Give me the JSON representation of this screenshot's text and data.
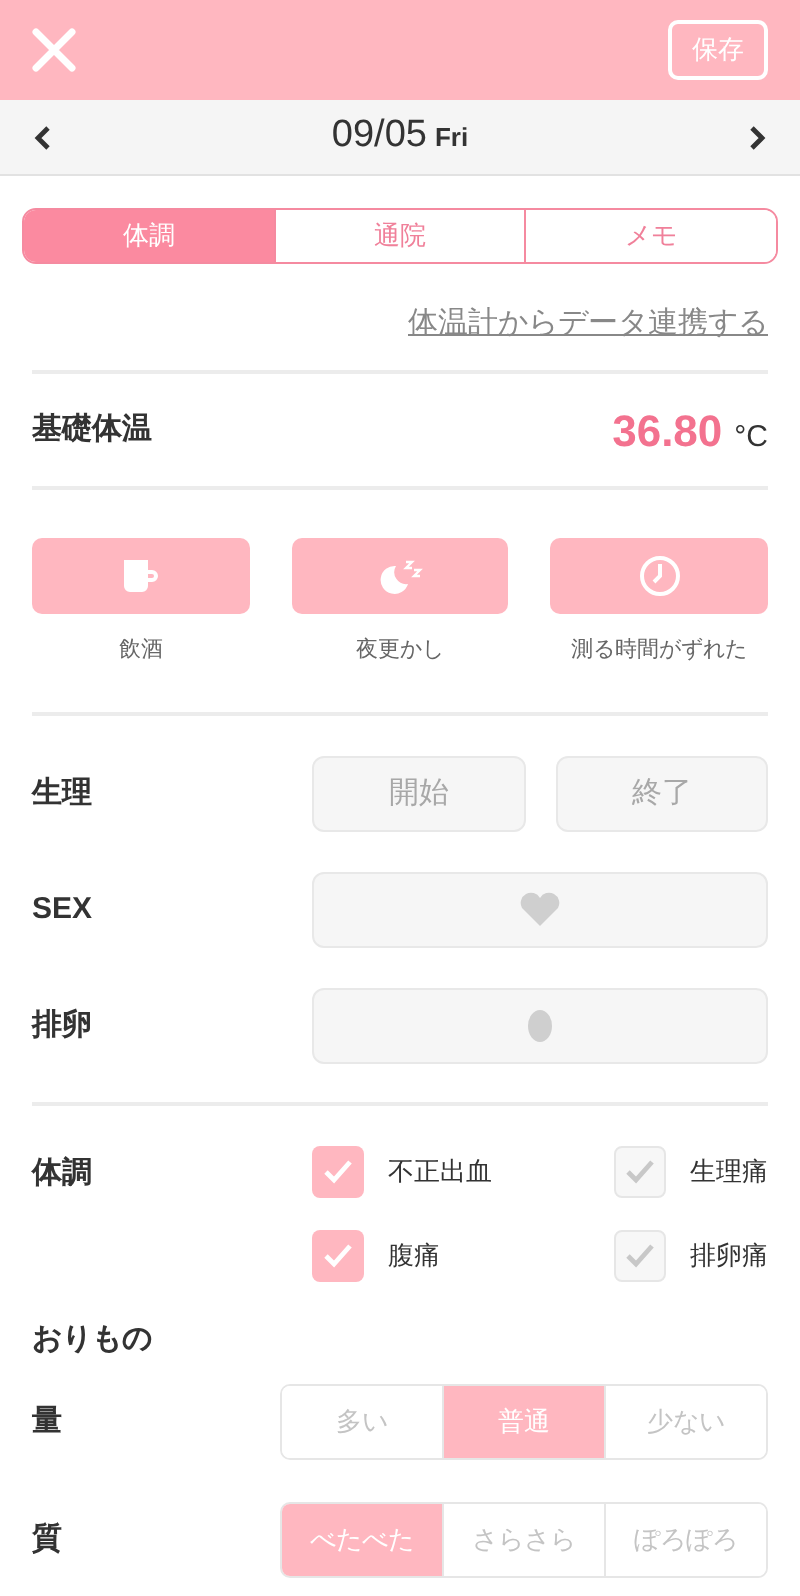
{
  "header": {
    "save_button": "保存"
  },
  "date_bar": {
    "date": "09/05",
    "weekday": "Fri"
  },
  "tabs": [
    {
      "label": "体調",
      "selected": true
    },
    {
      "label": "通院",
      "selected": false
    },
    {
      "label": "メモ",
      "selected": false
    }
  ],
  "sync_link": "体温計からデータ連携する",
  "basal_temperature": {
    "label": "基礎体温",
    "value": "36.80",
    "unit": "°C"
  },
  "events": [
    {
      "kind": "drink",
      "label": "飲酒"
    },
    {
      "kind": "night",
      "label": "夜更かし"
    },
    {
      "kind": "clock",
      "label": "測る時間がずれた"
    }
  ],
  "cycle_rows": [
    {
      "kind": "buttons",
      "label": "生理",
      "buttons": [
        "開始",
        "終了"
      ]
    },
    {
      "kind": "heart",
      "label": "SEX"
    },
    {
      "kind": "egg",
      "label": "排卵"
    }
  ],
  "condition": {
    "label": "体調",
    "items": [
      {
        "label": "不正出血",
        "checked": true
      },
      {
        "label": "生理痛",
        "checked": false
      },
      {
        "label": "腹痛",
        "checked": true
      },
      {
        "label": "排卵痛",
        "checked": false
      }
    ]
  },
  "discharge": {
    "title": "おりもの",
    "rows": [
      {
        "label": "量",
        "options": [
          {
            "label": "多い",
            "selected": false
          },
          {
            "label": "普通",
            "selected": true
          },
          {
            "label": "少ない",
            "selected": false
          }
        ]
      },
      {
        "label": "質",
        "options": [
          {
            "label": "べたべた",
            "selected": true
          },
          {
            "label": "さらさら",
            "selected": false
          },
          {
            "label": "ぽろぽろ",
            "selected": false
          }
        ]
      }
    ]
  }
}
